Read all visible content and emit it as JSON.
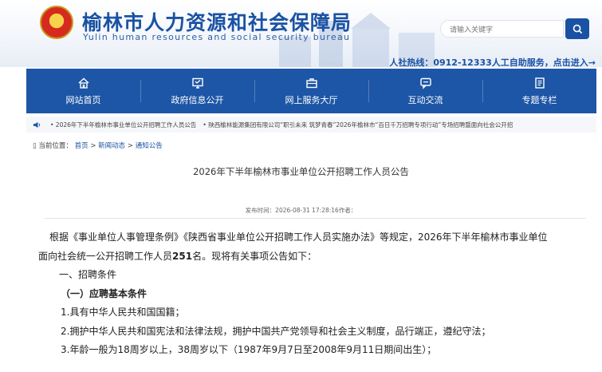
{
  "header": {
    "title": "榆林市人力资源和社会保障局",
    "subtitle": "Yulin human resources and social security bureau",
    "search_placeholder": "请输入关键字",
    "hotline": "人社热线：0912-12333人工自助服务，点击进入→"
  },
  "nav": {
    "items": [
      {
        "label": "网站首页",
        "icon": "home-icon"
      },
      {
        "label": "政府信息公开",
        "icon": "government-info-icon"
      },
      {
        "label": "网上服务大厅",
        "icon": "briefcase-icon"
      },
      {
        "label": "互动交流",
        "icon": "chat-icon"
      },
      {
        "label": "专题专栏",
        "icon": "topic-icon"
      }
    ]
  },
  "marquee": {
    "items": [
      "• 2026年下半年榆林市事业单位公开招聘工作人员公告",
      "• 陕西榆林能源集团有限公司“职引未来 筑梦青春”2026年榆林市“百日千万招聘专项行动”专场招聘暨面向社会公开招"
    ]
  },
  "breadcrumb": {
    "prefix": "当前位置：",
    "items": [
      "首页",
      "新闻动态",
      "通知公告"
    ],
    "sep": " > "
  },
  "article": {
    "title": "2026年下半年榆林市事业单位公开招聘工作人员公告",
    "meta": "发布时间：2026-08-31 17:28:16作者：",
    "paragraph1_line1": "根据《事业单位人事管理条例》《陕西省事业单位公开招聘工作人员实施办法》等规定，2026年下半年榆林市事业单位",
    "paragraph1_line2_a": "面向社会统一公开招聘工作人员",
    "paragraph1_line2_num": "251",
    "paragraph1_line2_b": "名。现将有关事项公告如下：",
    "section1": "一、招聘条件",
    "section1_sub": "（一）应聘基本条件",
    "item1": "1.具有中华人民共和国国籍；",
    "item2": "2.拥护中华人民共和国宪法和法律法规，拥护中国共产党领导和社会主义制度，品行端正，遵纪守法；",
    "item3": "3.年龄一般为18周岁以上，38周岁以下（1987年9月7日至2008年9月11日期间出生）；"
  }
}
